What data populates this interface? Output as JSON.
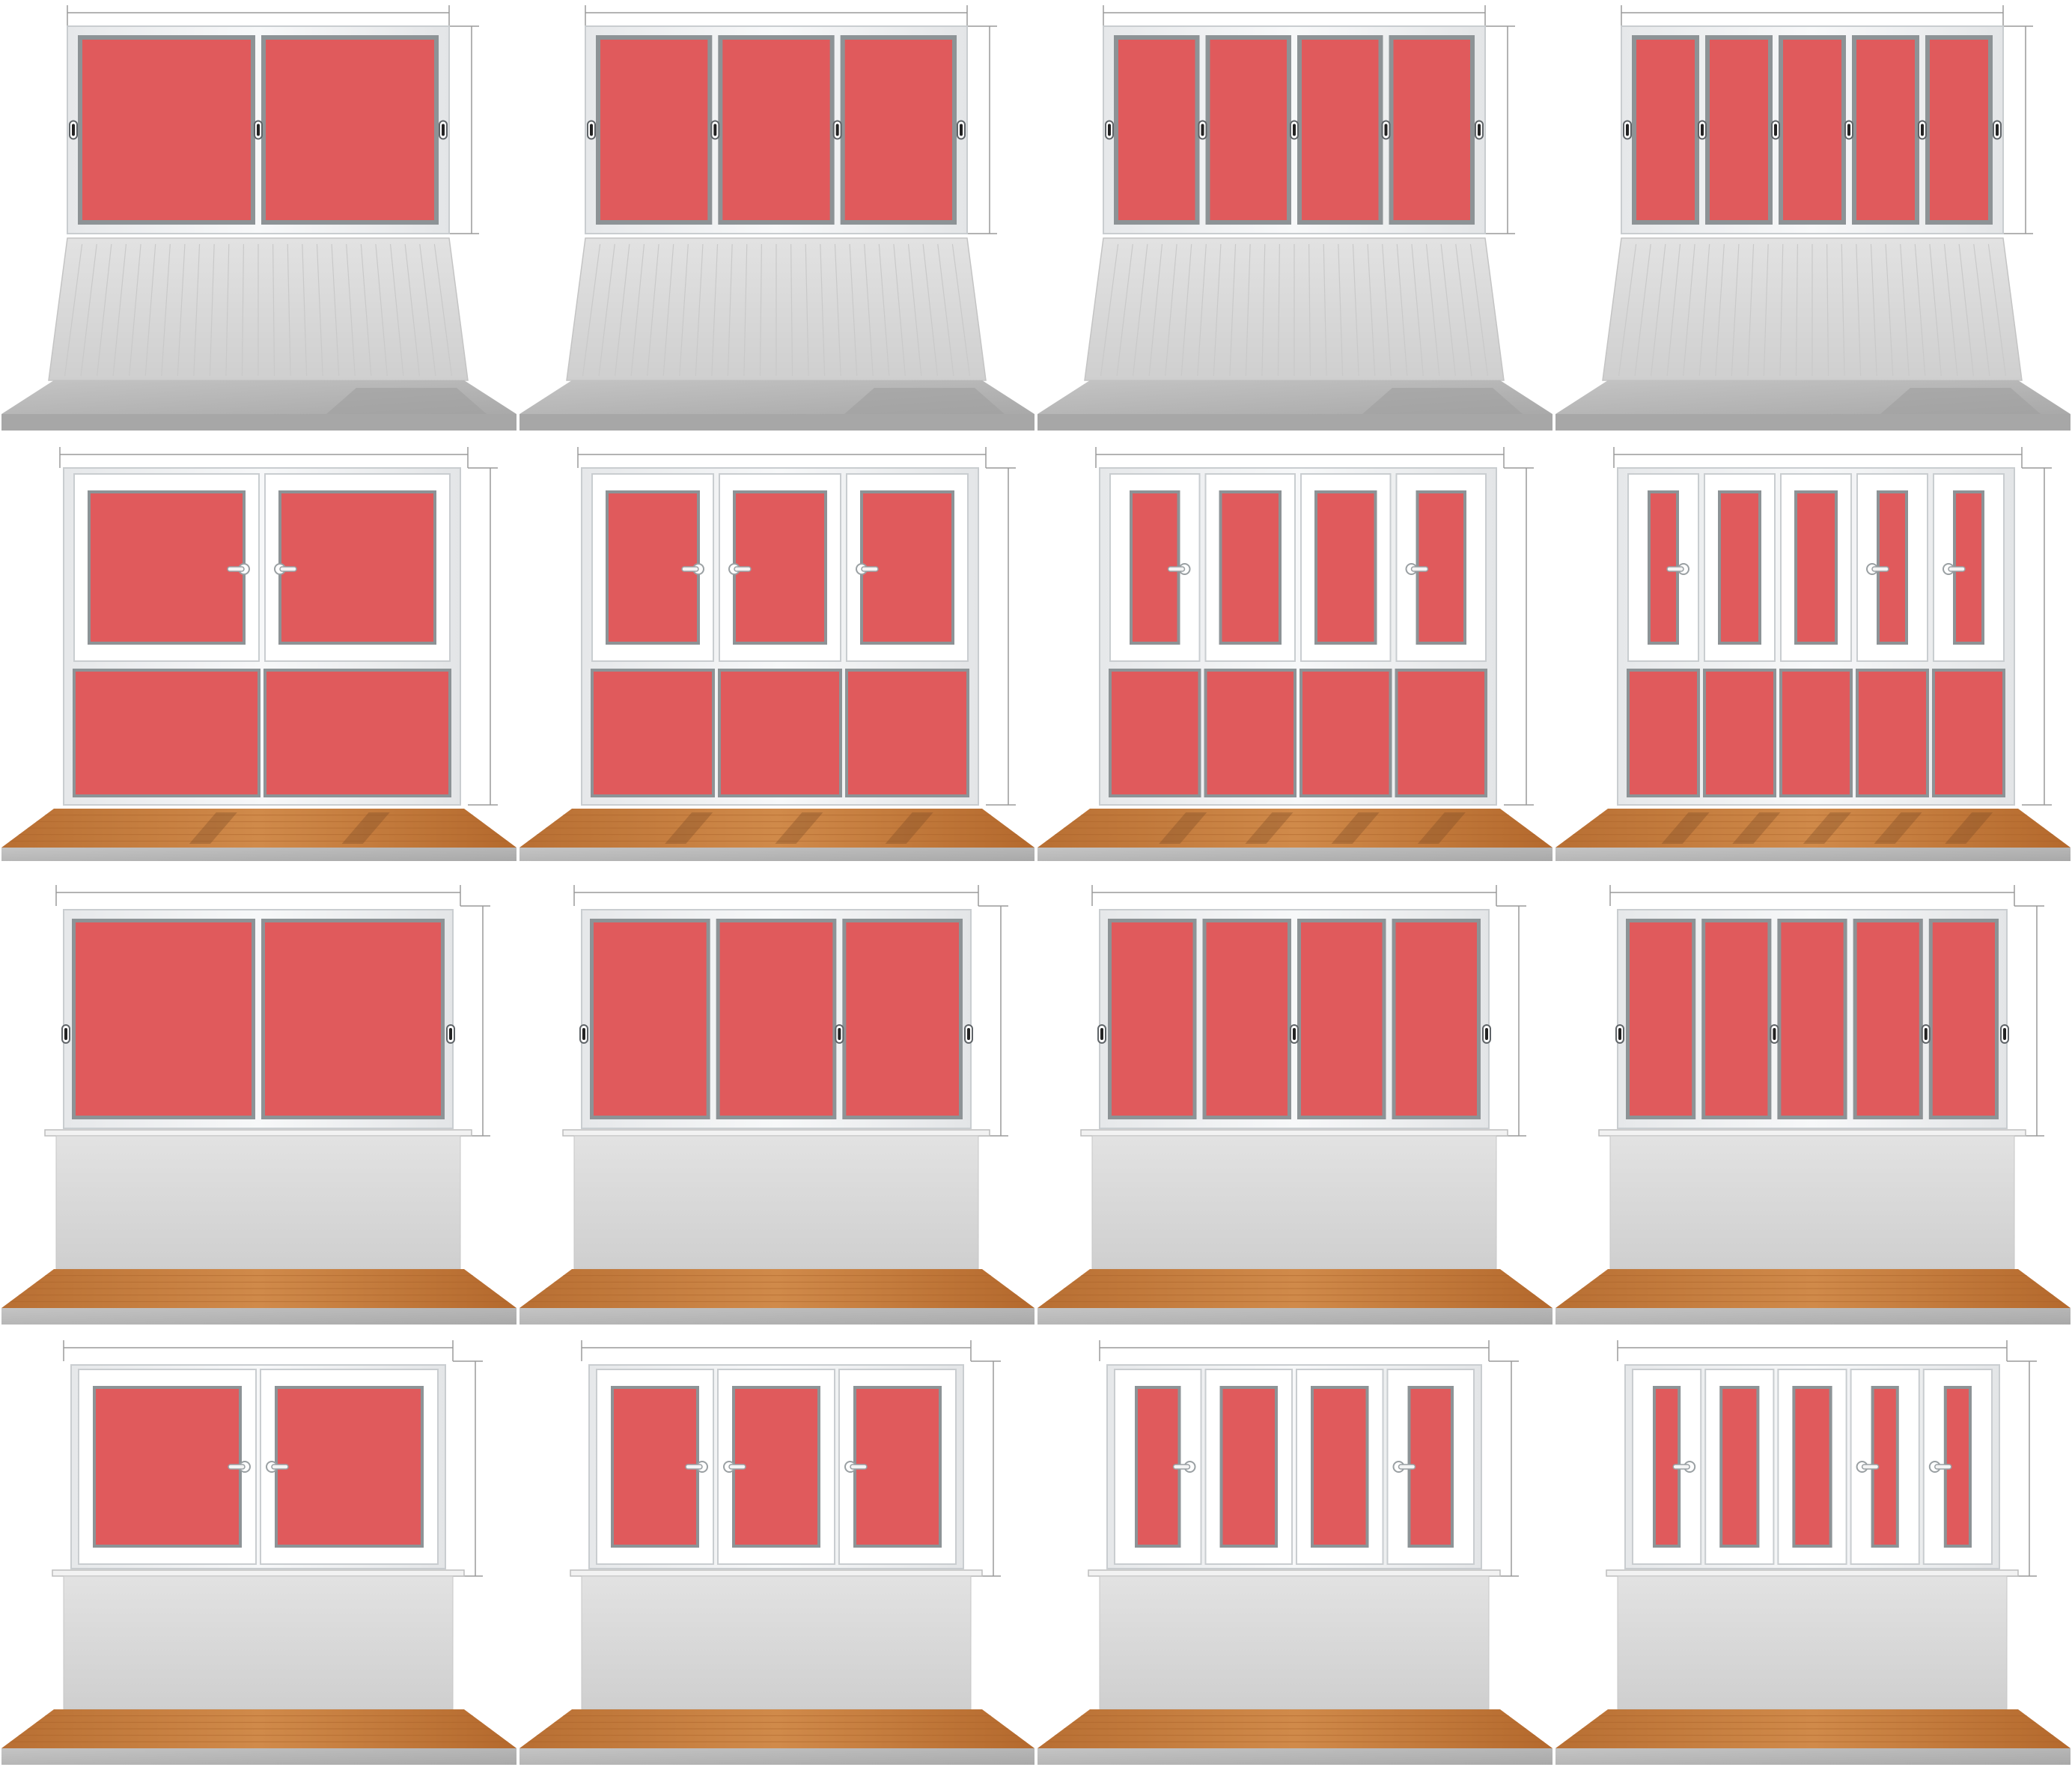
{
  "colors": {
    "glass": "#e05a5c",
    "frame": "#eeeff0",
    "frame_edge": "#c9cdd0",
    "seal": "#8d9396",
    "handle": "#5f6468",
    "panel": "#d8d8d8",
    "panel_slat": "#e7e7e7",
    "concrete": "#b7b7b7",
    "wood": "#c27a3c",
    "dimension_line": "#9a9a9a"
  },
  "variants": [
    {
      "id": "r1c1",
      "balcony_base": "slat-panel-concrete",
      "window_type": "sliding",
      "sash_count": 2
    },
    {
      "id": "r1c2",
      "balcony_base": "slat-panel-concrete",
      "window_type": "sliding",
      "sash_count": 3
    },
    {
      "id": "r1c3",
      "balcony_base": "slat-panel-concrete",
      "window_type": "sliding",
      "sash_count": 4
    },
    {
      "id": "r1c4",
      "balcony_base": "slat-panel-concrete",
      "window_type": "sliding",
      "sash_count": 5
    },
    {
      "id": "r2c1",
      "balcony_base": "full-height-glazing-wood",
      "window_type": "casement",
      "sash_count": 2
    },
    {
      "id": "r2c2",
      "balcony_base": "full-height-glazing-wood",
      "window_type": "casement",
      "sash_count": 3
    },
    {
      "id": "r2c3",
      "balcony_base": "full-height-glazing-wood",
      "window_type": "casement",
      "sash_count": 4
    },
    {
      "id": "r2c4",
      "balcony_base": "full-height-glazing-wood",
      "window_type": "casement",
      "sash_count": 5
    },
    {
      "id": "r3c1",
      "balcony_base": "parapet-wall-wood",
      "window_type": "sliding",
      "sash_count": 2
    },
    {
      "id": "r3c2",
      "balcony_base": "parapet-wall-wood",
      "window_type": "sliding",
      "sash_count": 3
    },
    {
      "id": "r3c3",
      "balcony_base": "parapet-wall-wood",
      "window_type": "sliding",
      "sash_count": 4
    },
    {
      "id": "r3c4",
      "balcony_base": "parapet-wall-wood",
      "window_type": "sliding",
      "sash_count": 5
    },
    {
      "id": "r4c1",
      "balcony_base": "parapet-wall-wood",
      "window_type": "casement",
      "sash_count": 2
    },
    {
      "id": "r4c2",
      "balcony_base": "parapet-wall-wood",
      "window_type": "casement",
      "sash_count": 3
    },
    {
      "id": "r4c3",
      "balcony_base": "parapet-wall-wood",
      "window_type": "casement",
      "sash_count": 4
    },
    {
      "id": "r4c4",
      "balcony_base": "parapet-wall-wood",
      "window_type": "casement",
      "sash_count": 5
    }
  ]
}
